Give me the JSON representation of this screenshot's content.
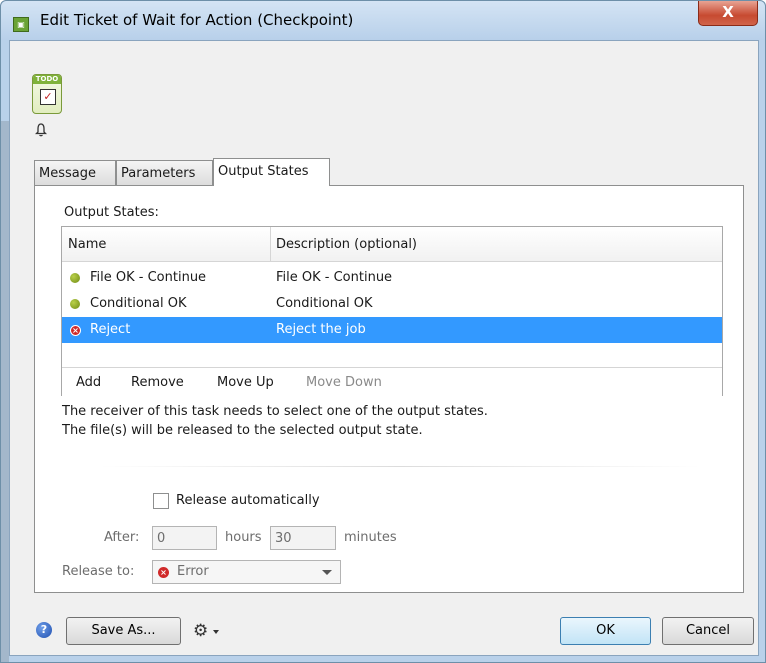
{
  "window": {
    "title": "Edit Ticket of Wait for Action (Checkpoint)",
    "close_label": "X"
  },
  "icons": {
    "task": "todo-checkbox-icon",
    "todo_label": "TODO",
    "bell": "bell-icon",
    "help": "help-icon",
    "gear": "gear-icon"
  },
  "tabs": [
    {
      "label": "Message",
      "active": false
    },
    {
      "label": "Parameters",
      "active": false
    },
    {
      "label": "Output States",
      "active": true
    }
  ],
  "output_states": {
    "section_label": "Output States:",
    "columns": {
      "name": "Name",
      "description": "Description (optional)"
    },
    "rows": [
      {
        "name": "File OK - Continue",
        "description": "File OK - Continue",
        "status": "green",
        "selected": false
      },
      {
        "name": "Conditional OK",
        "description": "Conditional OK",
        "status": "green",
        "selected": false
      },
      {
        "name": "Reject",
        "description": "Reject the job",
        "status": "red",
        "selected": true
      }
    ],
    "actions": {
      "add": "Add",
      "remove": "Remove",
      "move_up": "Move Up",
      "move_down": "Move Down"
    }
  },
  "info": {
    "line1": "The receiver of this task needs to select one of the output states.",
    "line2": "The file(s) will be released to the selected output state."
  },
  "release": {
    "auto_label": "Release automatically",
    "auto_checked": false,
    "after_label": "After:",
    "hours_value": "0",
    "hours_label": "hours",
    "minutes_value": "30",
    "minutes_label": "minutes",
    "release_to_label": "Release to:",
    "release_to_value": "Error"
  },
  "footer": {
    "save_as": "Save As...",
    "ok": "OK",
    "cancel": "Cancel"
  },
  "colors": {
    "selection": "#3399ff",
    "status_green": "#8aa61e",
    "status_red": "#d02a2a"
  }
}
